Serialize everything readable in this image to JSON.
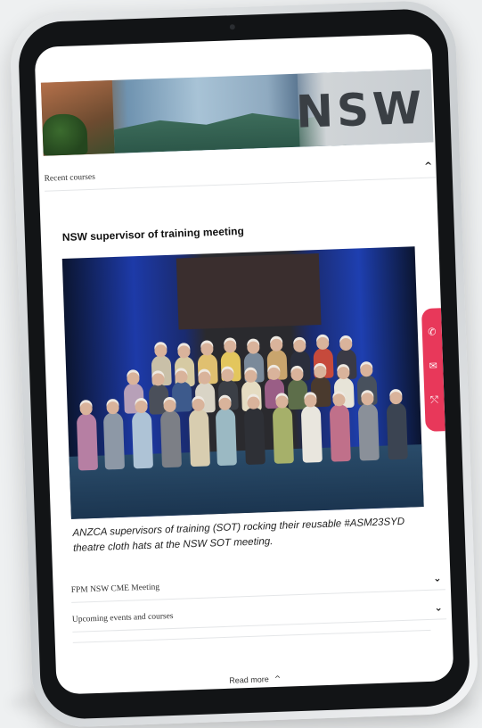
{
  "banner": {
    "text": "NSW"
  },
  "accordion_top": {
    "label": "Recent courses",
    "chevron": "^"
  },
  "article": {
    "title": "NSW supervisor of training meeting",
    "caption": "ANZCA supervisors of training (SOT) rocking their reusable #ASM23SYD theatre cloth hats at the NSW SOT meeting."
  },
  "accordions": [
    {
      "label": "FPM NSW CME Meeting",
      "chevron": "⌄"
    },
    {
      "label": "Upcoming events and courses",
      "chevron": "⌄"
    }
  ],
  "read_more": {
    "label": "Read more",
    "chevron": "^"
  },
  "side_actions": [
    {
      "icon": "phone-icon",
      "glyph": "✆"
    },
    {
      "icon": "mail-icon",
      "glyph": "✉"
    },
    {
      "icon": "share-icon",
      "glyph": "⤲"
    }
  ],
  "colors": {
    "accent": "#e8385a",
    "screen_bg": "#ffffff",
    "bezel": "#121416"
  }
}
